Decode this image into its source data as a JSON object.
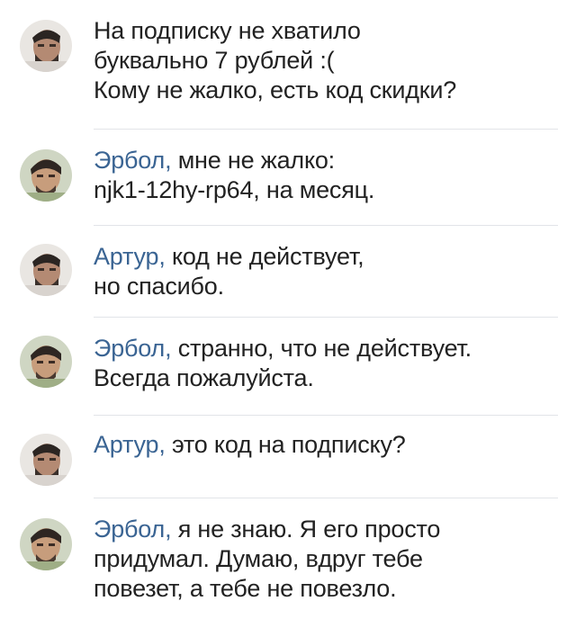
{
  "comments": [
    {
      "author": "",
      "lines": [
        "На подписку не хватило",
        "буквально 7 рублей :(",
        "Кому не жалко, есть код скидки?"
      ],
      "avatar_icon": "user-avatar-artur"
    },
    {
      "author": "Эрбол,",
      "lines": [
        "мне не жалко:",
        "njk1-12hy-rp64, на месяц."
      ],
      "avatar_icon": "user-avatar-erbol"
    },
    {
      "author": "Артур,",
      "lines": [
        "код не действует,",
        "но спасибо."
      ],
      "avatar_icon": "user-avatar-artur"
    },
    {
      "author": "Эрбол,",
      "lines": [
        "странно, что не действует.",
        "Всегда пожалуйста."
      ],
      "avatar_icon": "user-avatar-erbol"
    },
    {
      "author": "Артур,",
      "lines": [
        "это код на подписку?"
      ],
      "avatar_icon": "user-avatar-artur"
    },
    {
      "author": "Эрбол,",
      "lines": [
        "я не знаю. Я его просто",
        "придумал. Думаю, вдруг тебе",
        "повезет, а тебе не повезло."
      ],
      "avatar_icon": "user-avatar-erbol"
    }
  ],
  "colors": {
    "author_link": "#3a6493",
    "text": "#222222",
    "divider": "#e2e4e8"
  }
}
